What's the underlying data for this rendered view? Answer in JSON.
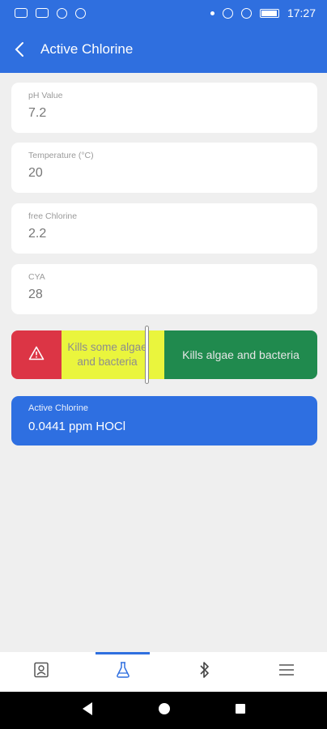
{
  "status_bar": {
    "time": "17:27",
    "left_icons": [
      "sim-icon",
      "signal-icon",
      "sync-icon",
      "cloud-icon"
    ],
    "right_icons": [
      "dot-icon",
      "vibrate-icon",
      "wifi-icon",
      "battery-icon"
    ]
  },
  "app_bar": {
    "title": "Active Chlorine",
    "back_icon": "chevron-left-icon"
  },
  "fields": [
    {
      "label": "pH Value",
      "value": "7.2"
    },
    {
      "label": "Temperature (°C)",
      "value": "20"
    },
    {
      "label": "free Chlorine",
      "value": "2.2"
    },
    {
      "label": "CYA",
      "value": "28"
    }
  ],
  "scale": {
    "warning_icon": "warning-icon",
    "yellow_text": "Kills some algae and bacteria",
    "green_text": "Kills algae and bacteria",
    "colors": {
      "red": "#dc3545",
      "yellow": "#eaf53d",
      "green": "#208a4e"
    }
  },
  "result": {
    "label": "Active Chlorine",
    "value": "0.0441 ppm HOCl"
  },
  "bottom_nav": {
    "items": [
      "profile-icon",
      "flask-icon",
      "bluetooth-icon",
      "menu-icon"
    ],
    "active": "flask-icon"
  },
  "system_nav": [
    "back-icon",
    "home-icon",
    "recents-icon"
  ],
  "colors": {
    "primary": "#2f6fdf",
    "background": "#efefef"
  }
}
